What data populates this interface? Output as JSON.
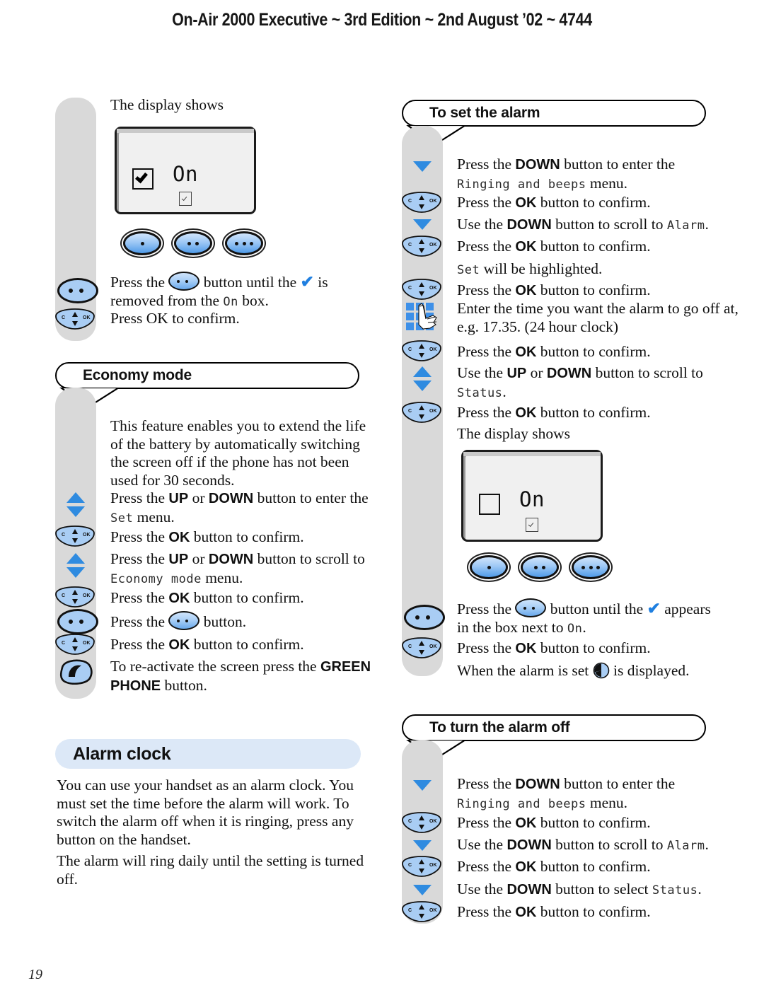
{
  "running_head": "On-Air 2000 Executive ~ 3rd Edition ~ 2nd August ’02 ~ 4744",
  "folio": "19",
  "colors": {
    "rail_grey": "#d9d9d9",
    "chapter_bar_blue": "#dce8f7",
    "accent_blue": "#2f8be0",
    "key_blue": "#a9cdf4",
    "tick_blue": "#1f7fe0"
  },
  "left_column": {
    "display_intro": "The display shows",
    "lcd": {
      "label": "On",
      "checkbox_state": "checked",
      "small_box_state": "checked"
    },
    "softkeys": [
      "one-dot",
      "two-dot",
      "three-dot"
    ],
    "steps": [
      {
        "icon": "softkey-two-dot-icon",
        "text_parts": [
          "Press the ",
          " button until the ",
          " is removed from the ",
          " box."
        ],
        "dm_word": "On"
      },
      {
        "icon": "nav-ok-pad-icon",
        "text": "Press OK to confirm."
      }
    ],
    "economy_section": {
      "title": "Economy mode",
      "intro": "This feature enables you to extend the life of the battery by automatically switching the screen off if the phone has not been used for 30 seconds.",
      "steps": [
        {
          "icon": "up-down-arrows-icon",
          "text": "Press the UP or DOWN button to enter the",
          "dm": "Set",
          "tail": " menu."
        },
        {
          "icon": "nav-ok-pad-icon",
          "text": "Press the OK button to confirm."
        },
        {
          "icon": "up-down-arrows-icon",
          "text": "Press the UP or DOWN button to scroll to",
          "dm": "Economy mode",
          "tail": " menu."
        },
        {
          "icon": "nav-ok-pad-icon",
          "text": "Press the OK button to confirm."
        },
        {
          "icon": "softkey-two-dot-icon",
          "text": "Press the   button."
        },
        {
          "icon": "nav-ok-pad-icon",
          "text": "Press the OK button to confirm."
        },
        {
          "icon": "green-phone-icon",
          "text": "To re-activate the screen press the GREEN PHONE button."
        }
      ]
    },
    "alarm_chapter": {
      "title": "Alarm clock",
      "paragraph_1": "You can use your handset as an alarm clock. You must set the time before the alarm will work. To switch the alarm off when it is ringing, press any button on the handset.",
      "paragraph_2": "The alarm will ring daily until the setting is turned off."
    }
  },
  "right_column": {
    "set_alarm_section": {
      "title": "To set the alarm",
      "steps": [
        {
          "icon": "down-arrow-icon",
          "text": "Press the DOWN button to enter the",
          "dm": "Ringing and beeps",
          "tail": " menu."
        },
        {
          "icon": "nav-ok-pad-icon",
          "text": "Press the OK button to confirm."
        },
        {
          "icon": "down-arrow-icon",
          "text": "Use the DOWN button to scroll to",
          "dm": "Alarm",
          "tail": "."
        },
        {
          "icon": "nav-ok-pad-icon",
          "text": "Press the OK button to confirm."
        },
        {
          "icon": "none",
          "dm": "Set",
          "text": " will be highlighted."
        },
        {
          "icon": "nav-ok-pad-icon",
          "text": "Press the OK button to confirm."
        },
        {
          "icon": "keypad-hand-icon",
          "text": "Enter the time you want the alarm to go off at, e.g. 17.35. (24 hour clock)"
        },
        {
          "icon": "nav-ok-pad-icon",
          "text": "Press the OK button to confirm."
        },
        {
          "icon": "up-down-arrows-icon",
          "text": "Use the UP or DOWN button to scroll to",
          "dm": "Status",
          "tail": "."
        },
        {
          "icon": "nav-ok-pad-icon",
          "text": "Press the OK button to confirm."
        },
        {
          "icon": "none",
          "text": "The display shows"
        }
      ],
      "lcd": {
        "label": "On",
        "checkbox_state": "unchecked",
        "small_box_state": "checked"
      },
      "softkeys": [
        "one-dot",
        "two-dot",
        "three-dot"
      ],
      "after_steps": [
        {
          "icon": "softkey-two-dot-icon",
          "text": "Press the   button until the ✔ appears in the box next to",
          "dm": "On",
          "tail": "."
        },
        {
          "icon": "nav-ok-pad-icon",
          "text": "Press the OK button to confirm."
        },
        {
          "icon": "none",
          "text": "When the alarm is set  is displayed."
        }
      ]
    },
    "turn_off_section": {
      "title": "To turn the alarm off",
      "steps": [
        {
          "icon": "down-arrow-icon",
          "text": "Press the DOWN button to enter the",
          "dm": "Ringing and beeps",
          "tail": " menu."
        },
        {
          "icon": "nav-ok-pad-icon",
          "text": "Press the OK button to confirm."
        },
        {
          "icon": "down-arrow-icon",
          "text": "Use the DOWN button to scroll to",
          "dm": "Alarm",
          "tail": "."
        },
        {
          "icon": "nav-ok-pad-icon",
          "text": "Press the OK button to confirm."
        },
        {
          "icon": "down-arrow-icon",
          "text": "Use the DOWN button to select",
          "dm": "Status",
          "tail": "."
        },
        {
          "icon": "nav-ok-pad-icon",
          "text": "Press the OK button to confirm."
        }
      ]
    }
  },
  "literals": {
    "press_the": "Press the",
    "button_until_the": "button until the",
    "is_removed_from_the": "is",
    "removed_line": "removed from the",
    "box_word": "box.",
    "press_ok_confirm_short": "Press OK to confirm.",
    "press_the_ok_button_to_confirm": "Press the OK button to confirm.",
    "button_word": "button.",
    "appears_word": "appears",
    "in_the_box_next_to": "in the box next to",
    "when_alarm_set_a": "When the alarm is set",
    "when_alarm_set_b": "is displayed.",
    "display_shows": "The display shows",
    "menu_word": "menu.",
    "use_the": "Use the",
    "or_word": "or",
    "to_scroll_to": "button to scroll to",
    "to_enter_the": "button to enter the",
    "UP": "UP",
    "DOWN": "DOWN",
    "OK": "OK",
    "GREEN": "GREEN",
    "PHONE": "PHONE"
  }
}
